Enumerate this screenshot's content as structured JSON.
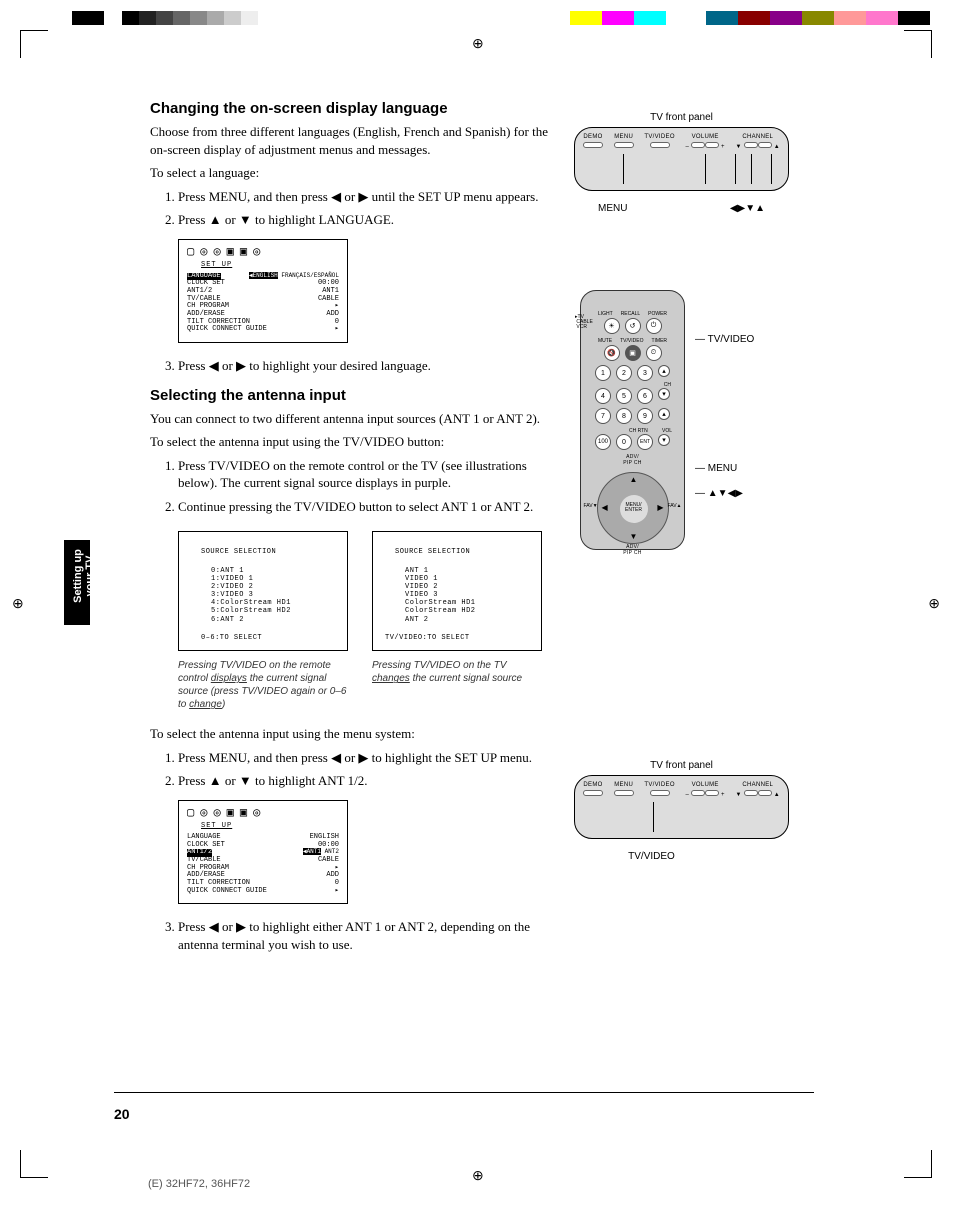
{
  "section1": {
    "heading": "Changing the on-screen display language",
    "intro": "Choose from three different languages (English, French and Spanish) for the on-screen display of adjustment menus and messages.",
    "lead": "To select a language:",
    "step1": "Press MENU, and then press ◀ or ▶ until the SET UP menu appears.",
    "step2": "Press ▲ or ▼ to highlight LANGUAGE.",
    "step3": "Press ◀ or ▶ to highlight your desired language."
  },
  "section2": {
    "heading": "Selecting the antenna input",
    "intro": "You can connect to two different antenna input sources (ANT 1 or ANT 2).",
    "leadA": "To select the antenna input using the TV/VIDEO button:",
    "stepA1": "Press TV/VIDEO on the remote control or the TV (see illustrations below). The current signal source displays in purple.",
    "stepA2": "Continue pressing the TV/VIDEO button to select ANT 1 or ANT 2.",
    "leadB": "To select the antenna input using the menu system:",
    "stepB1": "Press MENU, and then press ◀ or ▶ to highlight the SET UP menu.",
    "stepB2": "Press ▲ or ▼ to highlight ANT 1/2.",
    "stepB3": "Press ◀ or ▶ to highlight either ANT 1 or ANT 2, depending on the antenna terminal you wish to use."
  },
  "menuScreenshot": {
    "title": "SET UP",
    "rows": {
      "language_label": "LANGUAGE",
      "language_opts": "ENGLISH FRANCAIS/ESPANOL",
      "clock": "CLOCK SET",
      "clock_v": "00:00",
      "ant": "ANT1/2",
      "ant_v": "ANT1",
      "tvcable": "TV/CABLE",
      "tvcable_v": "CABLE",
      "chprog": "CH PROGRAM",
      "adderase": "ADD/ERASE",
      "adderase_v": "ADD",
      "tilt": "TILT CORRECTION",
      "tilt_v": "0",
      "qcg": "QUICK CONNECT GUIDE"
    }
  },
  "menuScreenshot2": {
    "ant_opts": "ANT1 ANT2",
    "lang_v": "ENGLISH"
  },
  "sourceBoxLeft": {
    "title": "SOURCE SELECTION",
    "lines": [
      "0:ANT 1",
      "1:VIDEO 1",
      "2:VIDEO 2",
      "3:VIDEO 3",
      "4:ColorStream HD1",
      "5:ColorStream HD2",
      "6:ANT 2"
    ],
    "footer": "0–6:TO SELECT",
    "caption_pre": "Pressing TV/VIDEO on the remote control ",
    "caption_u": "displays",
    "caption_post": " the current signal source (press TV/VIDEO again or 0–6 to ",
    "caption_u2": "change",
    "caption_end": ")"
  },
  "sourceBoxRight": {
    "title": "SOURCE SELECTION",
    "lines": [
      "ANT 1",
      "VIDEO 1",
      "VIDEO 2",
      "VIDEO 3",
      "ColorStream HD1",
      "ColorStream HD2",
      "ANT 2"
    ],
    "footer": "TV/VIDEO:TO SELECT",
    "caption_pre": "Pressing TV/VIDEO on the TV ",
    "caption_u": "changes",
    "caption_post": " the current signal source"
  },
  "tvPanel": {
    "title": "TV front panel",
    "buttons": [
      "DEMO",
      "MENU",
      "TV/VIDEO",
      "VOLUME",
      "CHANNEL"
    ],
    "labelMenu": "MENU",
    "labelArrows": "◀▶▼▲",
    "labelTvVideo": "TV/VIDEO"
  },
  "remote": {
    "row1": [
      "LIGHT",
      "RECALL",
      "POWER"
    ],
    "row2": [
      "MUTE",
      "TV/VIDEO",
      "TIMER"
    ],
    "dpadCenter": "MENU/\nENTER",
    "sidelabels": [
      "TV/VIDEO",
      "MENU",
      "▲▼◀▶"
    ],
    "switchLabels": [
      "TV",
      "CABLE",
      "VCR"
    ],
    "favLeft": "FAV▼",
    "favRight": "FAV▲",
    "pipTop": "ADV/\nPIP CH",
    "pipBot": "ADV/\nPIP CH",
    "chLabel": "CH",
    "volLabel": "VOL",
    "chRtn": "CH RTN",
    "ent": "ENT",
    "hundred": "100"
  },
  "sidetab": {
    "l1": "Setting up",
    "l2": "your TV"
  },
  "pageNumber": "20",
  "footer": "(E) 32HF72, 36HF72"
}
